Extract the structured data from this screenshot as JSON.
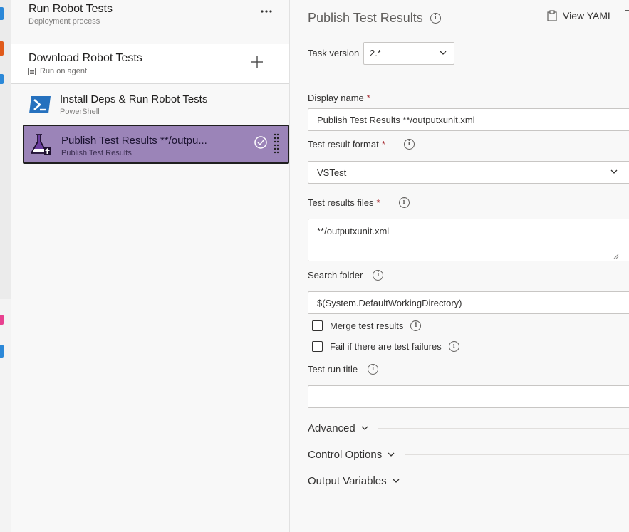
{
  "colors": {
    "accent": "#8661c5",
    "selected_task_bg": "#9b84b8",
    "required": "#a4262c"
  },
  "pipeline": {
    "title": "Run Robot Tests",
    "subtitle": "Deployment process",
    "more_icon": "ellipsis-icon",
    "job": {
      "title": "Download Robot Tests",
      "subtitle": "Run on agent",
      "add_icon": "plus-icon",
      "agent_icon": "server-icon"
    },
    "tasks": [
      {
        "title": "Install Deps & Run Robot Tests",
        "subtitle": "PowerShell",
        "icon": "powershell-icon"
      },
      {
        "title": "Publish Test Results **/outpu...",
        "subtitle": "Publish Test Results",
        "icon": "test-results-icon"
      }
    ]
  },
  "details": {
    "title": "Publish Test Results",
    "view_yaml": "View YAML",
    "task_version_label": "Task version",
    "task_version_value": "2.*",
    "display_name_label": "Display name",
    "display_name_value": "Publish Test Results **/outputxunit.xml",
    "required_mark": "*",
    "format_label": "Test result format",
    "format_value": "VSTest",
    "files_label": "Test results files",
    "files_value": "**/outputxunit.xml",
    "search_folder_label": "Search folder",
    "search_folder_value": "$(System.DefaultWorkingDirectory)",
    "merge_label": "Merge test results",
    "merge_checked": false,
    "fail_label": "Fail if there are test failures",
    "fail_checked": false,
    "run_title_label": "Test run title",
    "run_title_value": "",
    "sections": [
      "Advanced",
      "Control Options",
      "Output Variables"
    ]
  }
}
